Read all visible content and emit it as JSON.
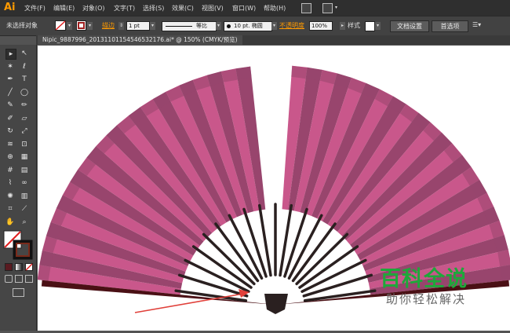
{
  "app": {
    "logo": "Ai"
  },
  "menu": [
    "文件(F)",
    "编辑(E)",
    "对象(O)",
    "文字(T)",
    "选择(S)",
    "效果(C)",
    "视图(V)",
    "窗口(W)",
    "帮助(H)"
  ],
  "control": {
    "selection_label": "未选择对象",
    "stroke_label": "描边",
    "stroke_weight": "1 pt",
    "profile_label": "等比",
    "brush_label": "10 pt. 椭圆",
    "opacity_label": "不透明度",
    "opacity_value": "100%",
    "style_label": "样式",
    "doc_settings": "文档设置",
    "preferences": "首选项"
  },
  "tab": {
    "title": "Nipic_9887996_20131101154546532176.ai* @ 150% (CMYK/预览)"
  },
  "canvas": {
    "background": "#ffffff"
  },
  "colors": {
    "fan_pink": "#c9578b",
    "fan_dark": "#98456d",
    "rib": "#2a2020",
    "edge": "#4a1015",
    "arrow": "#e0403a"
  },
  "watermark": {
    "title": "百科全说",
    "subtitle": "助你轻松解决"
  },
  "tools": [
    "selection-icon",
    "direct-selection-icon",
    "magic-wand-icon",
    "lasso-icon",
    "pen-icon",
    "type-icon",
    "line-icon",
    "ellipse-icon",
    "brush-icon",
    "pencil-icon",
    "blob-brush-icon",
    "eraser-icon",
    "rotate-icon",
    "scale-icon",
    "warp-icon",
    "free-transform-icon",
    "shape-builder-icon",
    "perspective-icon",
    "mesh-icon",
    "gradient-icon",
    "eyedropper-icon",
    "blend-icon",
    "symbol-sprayer-icon",
    "graph-icon",
    "artboard-icon",
    "slice-icon",
    "hand-icon",
    "zoom-icon"
  ]
}
